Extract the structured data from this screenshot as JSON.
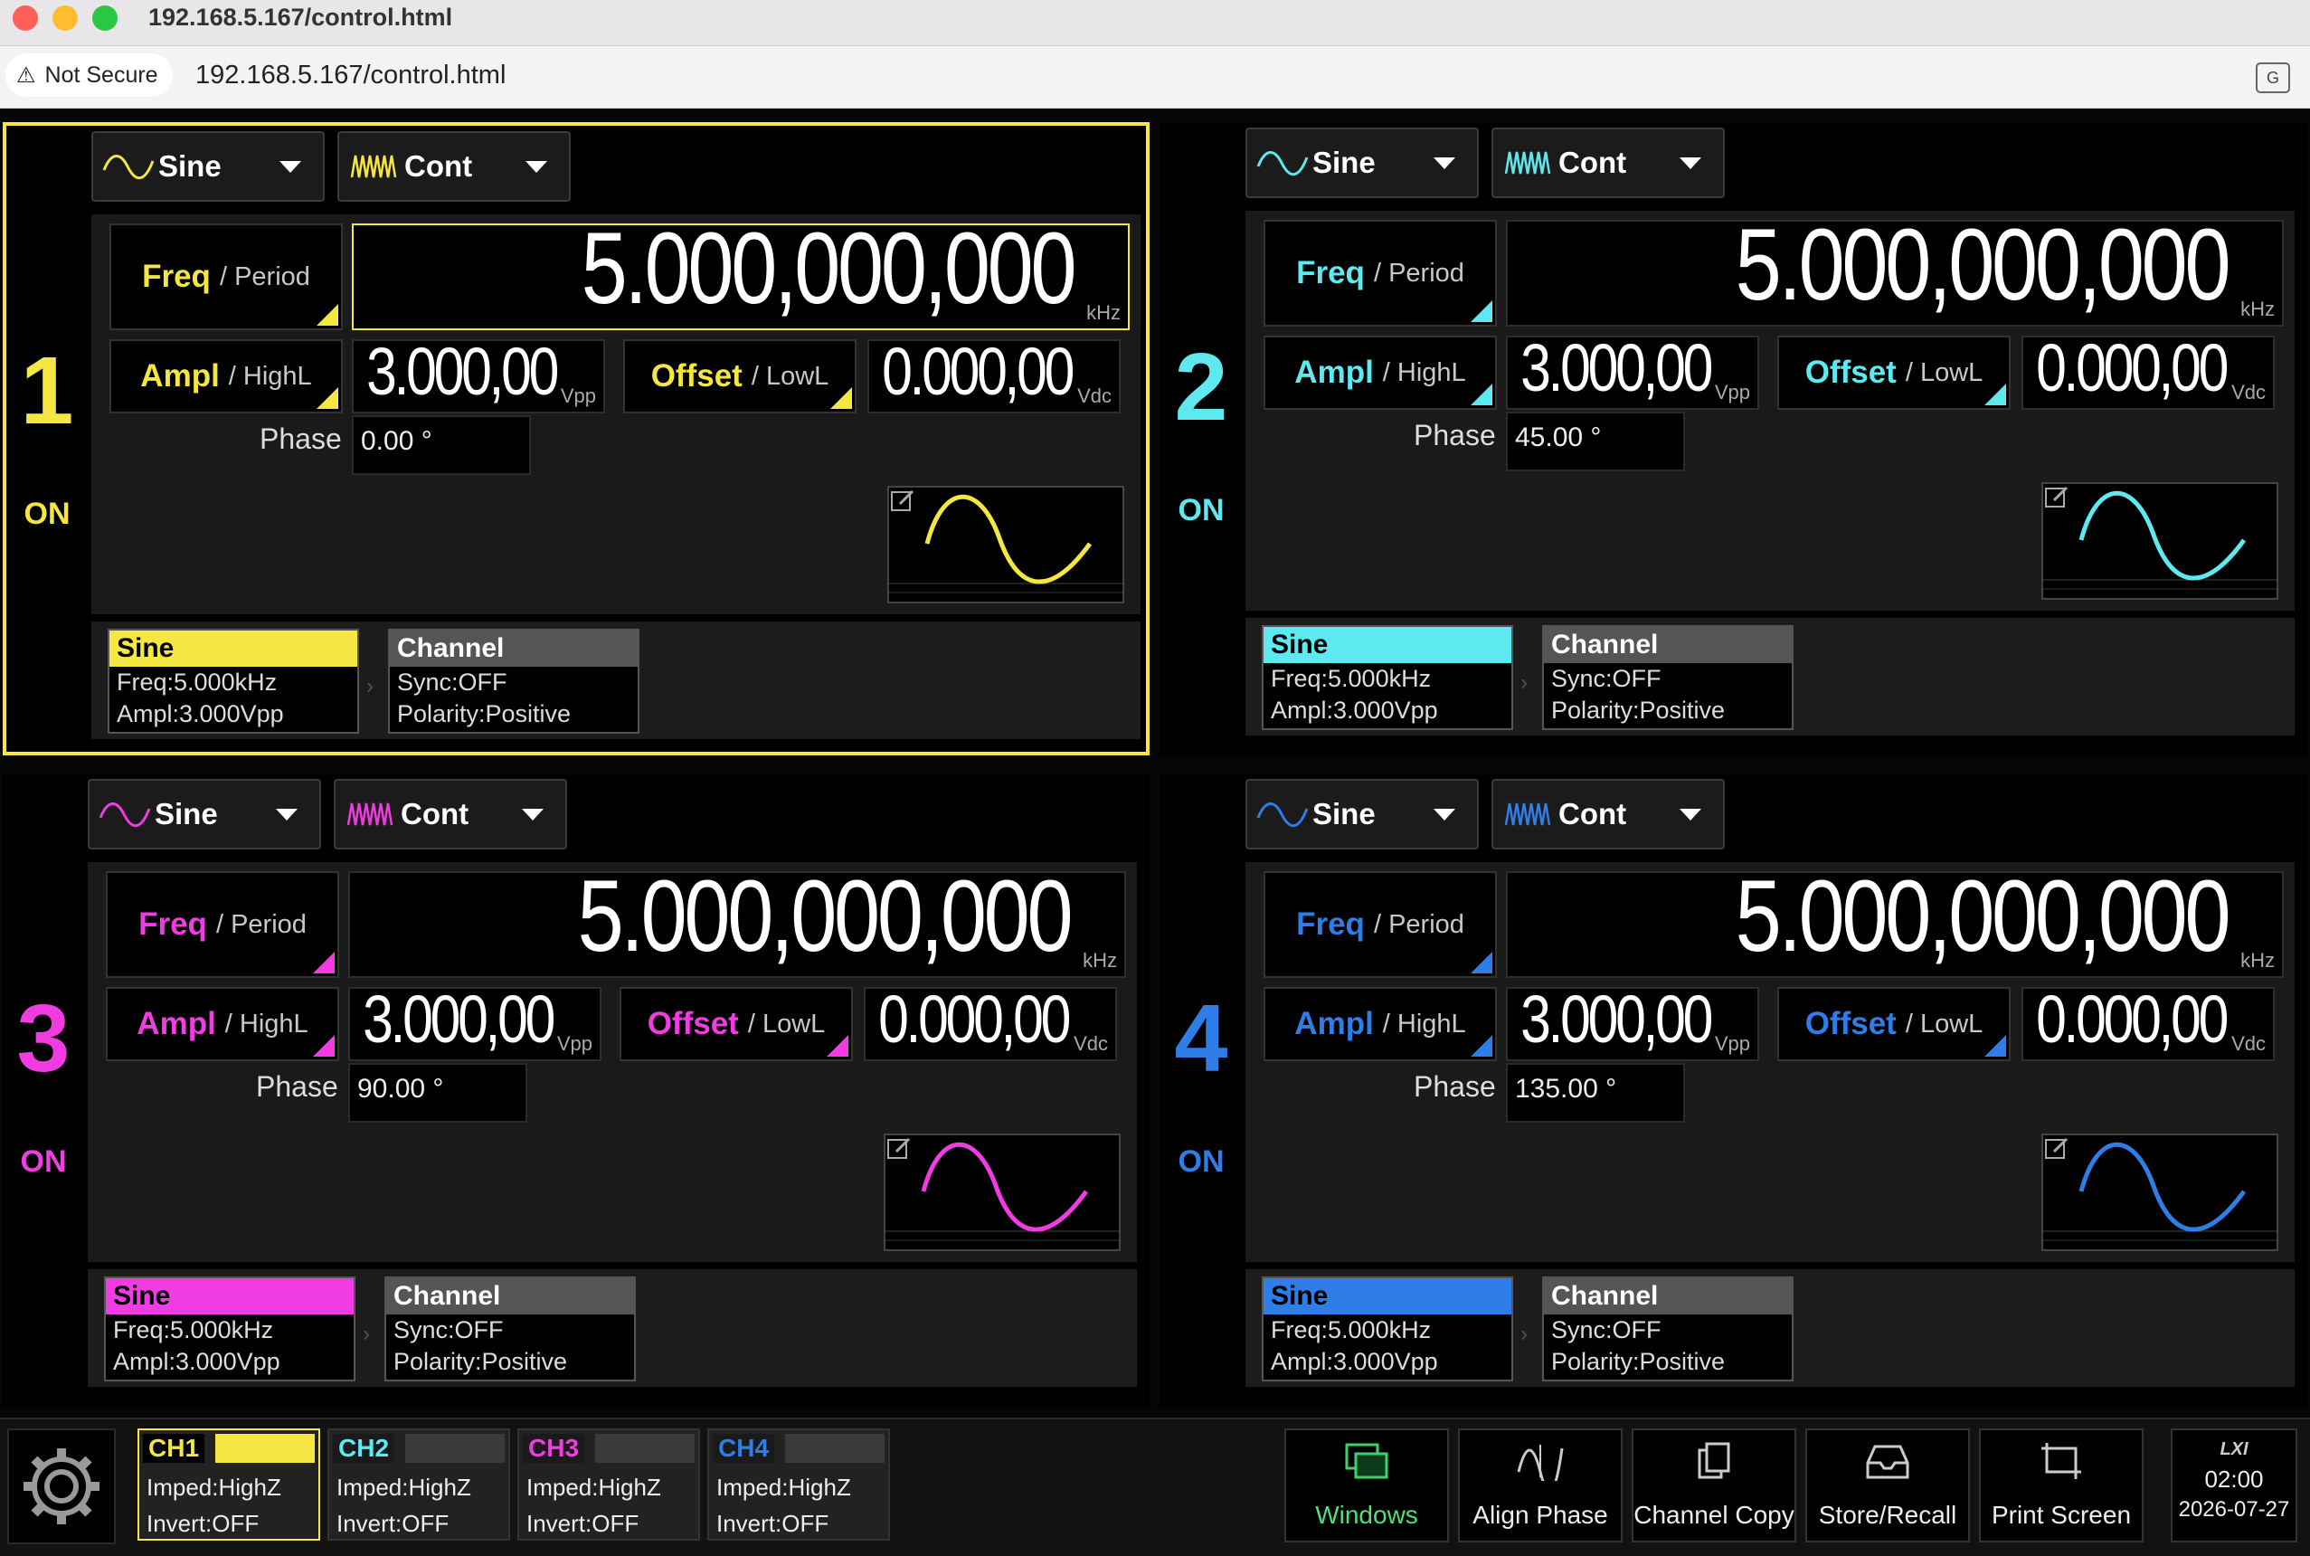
{
  "browser": {
    "title": "192.168.5.167/control.html",
    "not_secure": "Not Secure",
    "url": "192.168.5.167/control.html"
  },
  "channels": [
    {
      "number": "1",
      "state": "ON",
      "color": "#f5e642",
      "wave": "Sine",
      "mode": "Cont",
      "freq_label": "Freq",
      "period_label": "/ Period",
      "freq_value": "5.000,000,000",
      "freq_unit": "kHz",
      "ampl_label": "Ampl",
      "highl_label": "/ HighL",
      "ampl_value": "3.000,00",
      "ampl_unit": "Vpp",
      "offset_label": "Offset",
      "lowl_label": "/ LowL",
      "offset_value": "0.000,00",
      "offset_unit": "Vdc",
      "phase_label": "Phase",
      "phase_value": "0.00 °",
      "card": {
        "title": "Sine",
        "freq": "Freq:5.000kHz",
        "ampl": "Ampl:3.000Vpp"
      },
      "channel_card": {
        "title": "Channel",
        "sync": "Sync:OFF",
        "polarity": "Polarity:Positive"
      }
    },
    {
      "number": "2",
      "state": "ON",
      "color": "#5ee8f0",
      "wave": "Sine",
      "mode": "Cont",
      "freq_label": "Freq",
      "period_label": "/ Period",
      "freq_value": "5.000,000,000",
      "freq_unit": "kHz",
      "ampl_label": "Ampl",
      "highl_label": "/ HighL",
      "ampl_value": "3.000,00",
      "ampl_unit": "Vpp",
      "offset_label": "Offset",
      "lowl_label": "/ LowL",
      "offset_value": "0.000,00",
      "offset_unit": "Vdc",
      "phase_label": "Phase",
      "phase_value": "45.00 °",
      "card": {
        "title": "Sine",
        "freq": "Freq:5.000kHz",
        "ampl": "Ampl:3.000Vpp"
      },
      "channel_card": {
        "title": "Channel",
        "sync": "Sync:OFF",
        "polarity": "Polarity:Positive"
      }
    },
    {
      "number": "3",
      "state": "ON",
      "color": "#f03ce0",
      "wave": "Sine",
      "mode": "Cont",
      "freq_label": "Freq",
      "period_label": "/ Period",
      "freq_value": "5.000,000,000",
      "freq_unit": "kHz",
      "ampl_label": "Ampl",
      "highl_label": "/ HighL",
      "ampl_value": "3.000,00",
      "ampl_unit": "Vpp",
      "offset_label": "Offset",
      "lowl_label": "/ LowL",
      "offset_value": "0.000,00",
      "offset_unit": "Vdc",
      "phase_label": "Phase",
      "phase_value": "90.00 °",
      "card": {
        "title": "Sine",
        "freq": "Freq:5.000kHz",
        "ampl": "Ampl:3.000Vpp"
      },
      "channel_card": {
        "title": "Channel",
        "sync": "Sync:OFF",
        "polarity": "Polarity:Positive"
      }
    },
    {
      "number": "4",
      "state": "ON",
      "color": "#2f7de6",
      "wave": "Sine",
      "mode": "Cont",
      "freq_label": "Freq",
      "period_label": "/ Period",
      "freq_value": "5.000,000,000",
      "freq_unit": "kHz",
      "ampl_label": "Ampl",
      "highl_label": "/ HighL",
      "ampl_value": "3.000,00",
      "ampl_unit": "Vpp",
      "offset_label": "Offset",
      "lowl_label": "/ LowL",
      "offset_value": "0.000,00",
      "offset_unit": "Vdc",
      "phase_label": "Phase",
      "phase_value": "135.00 °",
      "card": {
        "title": "Sine",
        "freq": "Freq:5.000kHz",
        "ampl": "Ampl:3.000Vpp"
      },
      "channel_card": {
        "title": "Channel",
        "sync": "Sync:OFF",
        "polarity": "Polarity:Positive"
      }
    }
  ],
  "status_bar": {
    "ch_tabs": [
      {
        "name": "CH1",
        "imped": "Imped:HighZ",
        "invert": "Invert:OFF"
      },
      {
        "name": "CH2",
        "imped": "Imped:HighZ",
        "invert": "Invert:OFF"
      },
      {
        "name": "CH3",
        "imped": "Imped:HighZ",
        "invert": "Invert:OFF"
      },
      {
        "name": "CH4",
        "imped": "Imped:HighZ",
        "invert": "Invert:OFF"
      }
    ],
    "buttons": {
      "windows": "Windows",
      "align_phase": "Align Phase",
      "channel_copy": "Channel Copy",
      "store_recall": "Store/Recall",
      "print_screen": "Print Screen"
    },
    "lxi": "LXI",
    "time": "02:00",
    "date": "2026-07-27"
  }
}
